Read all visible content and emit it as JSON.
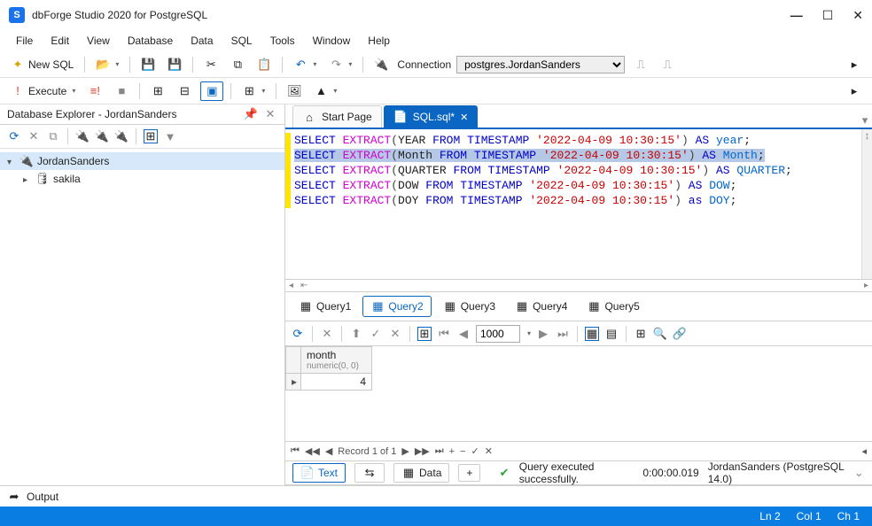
{
  "window": {
    "title": "dbForge Studio 2020 for PostgreSQL",
    "logo_letter": "S"
  },
  "menu": [
    "File",
    "Edit",
    "View",
    "Database",
    "Data",
    "SQL",
    "Tools",
    "Window",
    "Help"
  ],
  "toolbar1": {
    "new_sql": "New SQL",
    "connection_label": "Connection",
    "connection_value": "postgres.JordanSanders"
  },
  "toolbar2": {
    "execute": "Execute"
  },
  "db_explorer": {
    "title": "Database Explorer - JordanSanders",
    "tree": {
      "root": "JordanSanders",
      "db": "sakila"
    }
  },
  "editor": {
    "tabs": {
      "start": "Start Page",
      "sql": "SQL.sql*"
    },
    "code_lines": [
      "SELECT EXTRACT(YEAR FROM TIMESTAMP '2022-04-09 10:30:15') AS year;",
      "SELECT EXTRACT(Month FROM TIMESTAMP '2022-04-09 10:30:15') AS Month;",
      "SELECT EXTRACT(QUARTER FROM TIMESTAMP '2022-04-09 10:30:15') AS QUARTER;",
      "SELECT EXTRACT(DOW FROM TIMESTAMP '2022-04-09 10:30:15') AS DOW;",
      "SELECT EXTRACT(DOY FROM TIMESTAMP '2022-04-09 10:30:15') as DOY;"
    ],
    "selected_line_index": 1
  },
  "result": {
    "tabs": [
      "Query1",
      "Query2",
      "Query3",
      "Query4",
      "Query5"
    ],
    "active_tab": "Query2",
    "page_size": "1000",
    "column_name": "month",
    "column_type": "numeric(0, 0)",
    "value": "4",
    "nav_label": "Record 1 of 1"
  },
  "status": {
    "text_btn": "Text",
    "data_btn": "Data",
    "message": "Query executed successfully.",
    "time": "0:00:00.019",
    "conn": "JordanSanders (PostgreSQL 14.0)"
  },
  "output_label": "Output",
  "cursor": {
    "ln": "Ln 2",
    "col": "Col 1",
    "ch": "Ch 1"
  }
}
